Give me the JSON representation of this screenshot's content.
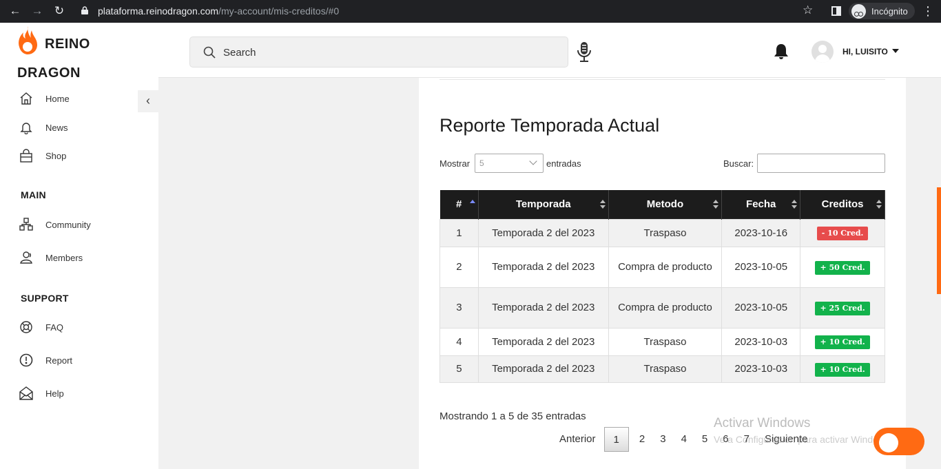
{
  "browser": {
    "url_host": "plataforma.reinodragon.com",
    "url_path": "/my-account/mis-creditos/#0",
    "incognito_label": "Incógnito"
  },
  "brand": {
    "line1": "REINO",
    "line2": "DRAGON",
    "color": "#ff6a13"
  },
  "sidebar": {
    "items": [
      {
        "label": "Home",
        "icon": "home-icon"
      },
      {
        "label": "News",
        "icon": "bell-icon"
      },
      {
        "label": "Shop",
        "icon": "shopping-bag-icon"
      }
    ],
    "main_title": "MAIN",
    "main_items": [
      {
        "label": "Community",
        "icon": "community-icon"
      },
      {
        "label": "Members",
        "icon": "members-icon"
      }
    ],
    "support_title": "SUPPORT",
    "support_items": [
      {
        "label": "FAQ",
        "icon": "lifebuoy-icon"
      },
      {
        "label": "Report",
        "icon": "alert-circle-icon"
      },
      {
        "label": "Help",
        "icon": "envelope-open-icon"
      }
    ]
  },
  "header": {
    "search_placeholder": "Search",
    "user_name": "HI, LUISITO"
  },
  "report": {
    "title": "Reporte Temporada Actual",
    "length_label": "Mostrar",
    "length_value": "5",
    "length_after": "entradas",
    "search_label": "Buscar:",
    "columns": [
      "#",
      "Temporada",
      "Metodo",
      "Fecha",
      "Creditos"
    ],
    "rows": [
      {
        "n": "1",
        "season": "Temporada 2 del 2023",
        "method": "Traspaso",
        "date": "2023-10-16",
        "credits": "- 10 Cred.",
        "type": "neg"
      },
      {
        "n": "2",
        "season": "Temporada 2 del 2023",
        "method": "Compra de producto",
        "date": "2023-10-05",
        "credits": "+ 50 Cred.",
        "type": "pos"
      },
      {
        "n": "3",
        "season": "Temporada 2 del 2023",
        "method": "Compra de producto",
        "date": "2023-10-05",
        "credits": "+ 25 Cred.",
        "type": "pos"
      },
      {
        "n": "4",
        "season": "Temporada 2 del 2023",
        "method": "Traspaso",
        "date": "2023-10-03",
        "credits": "+ 10 Cred.",
        "type": "pos"
      },
      {
        "n": "5",
        "season": "Temporada 2 del 2023",
        "method": "Traspaso",
        "date": "2023-10-03",
        "credits": "+ 10 Cred.",
        "type": "pos"
      }
    ],
    "info": "Mostrando 1 a 5 de 35 entradas",
    "pager": {
      "prev": "Anterior",
      "pages": [
        "1",
        "2",
        "3",
        "4",
        "5",
        "6",
        "7"
      ],
      "current": "1",
      "next": "Siguiente"
    }
  },
  "watermark": {
    "line1": "Activar Windows",
    "line2": "Ve a Configuración para activar Windows."
  }
}
